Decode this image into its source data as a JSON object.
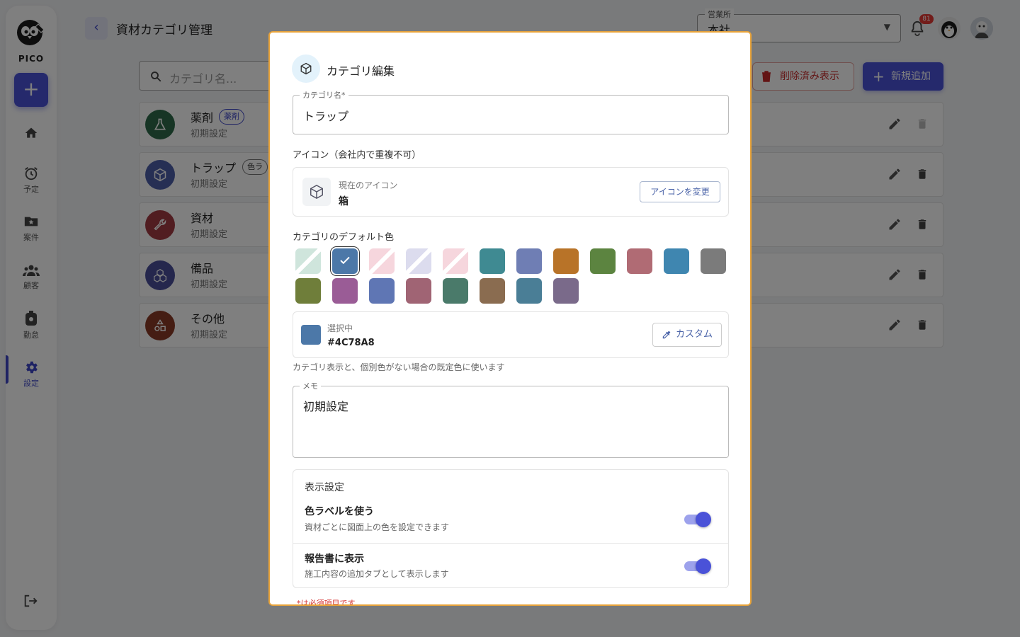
{
  "app": {
    "logo_text": "PICO"
  },
  "sidebar": {
    "items": [
      {
        "label": "",
        "icon": "home-icon"
      },
      {
        "label": "予定",
        "icon": "alarm-icon"
      },
      {
        "label": "案件",
        "icon": "folder-star-icon"
      },
      {
        "label": "顧客",
        "icon": "group-icon"
      },
      {
        "label": "勤怠",
        "icon": "timer-icon"
      },
      {
        "label": "設定",
        "icon": "gear-icon",
        "active": true
      }
    ]
  },
  "header": {
    "title": "資材カテゴリ管理",
    "office_label": "営業所",
    "office_value": "本社",
    "notification_count": "81"
  },
  "toolbar": {
    "search_placeholder": "カテゴリ名...",
    "show_deleted_label": "削除済み表示",
    "new_label": "新規追加"
  },
  "categories": [
    {
      "name": "薬剤",
      "badge": "薬剤",
      "memo": "初期設定",
      "color": "#2e6b4a",
      "icon": "flask-icon"
    },
    {
      "name": "トラップ",
      "badge": "色ラ",
      "memo": "初期設定",
      "color": "#4c5ea8",
      "icon": "box-icon"
    },
    {
      "name": "資材",
      "badge": "",
      "memo": "初期設定",
      "color": "#a33a42",
      "icon": "wrench-icon"
    },
    {
      "name": "備品",
      "badge": "",
      "memo": "初期設定",
      "color": "#4a4f9a",
      "icon": "cubes-icon"
    },
    {
      "name": "その他",
      "badge": "",
      "memo": "初期設定",
      "color": "#8a3b27",
      "icon": "shapes-icon"
    }
  ],
  "dialog": {
    "title": "カテゴリ編集",
    "name_label": "カテゴリ名*",
    "name_value": "トラップ",
    "icon_section_label": "アイコン（会社内で重複不可）",
    "current_icon_caption": "現在のアイコン",
    "current_icon_name": "箱",
    "change_icon_label": "アイコンを変更",
    "color_section_label": "カテゴリのデフォルト色",
    "swatches": [
      {
        "color": "#cfe5dc",
        "disabled": true
      },
      {
        "color": "#4c78a8",
        "selected": true
      },
      {
        "color": "#f6d6dd",
        "disabled": true
      },
      {
        "color": "#dcdcee",
        "disabled": true
      },
      {
        "color": "#f6d6dd",
        "disabled": true
      },
      {
        "color": "#3f8a92"
      },
      {
        "color": "#6f7eb4"
      },
      {
        "color": "#b87328"
      },
      {
        "color": "#5c8440"
      },
      {
        "color": "#b06b74"
      },
      {
        "color": "#3f86b0"
      },
      {
        "color": "#7b7b7b"
      },
      {
        "color": "#6f7e3a"
      },
      {
        "color": "#9a5c96"
      },
      {
        "color": "#5f76b4"
      },
      {
        "color": "#a06474"
      },
      {
        "color": "#4a7a6a"
      },
      {
        "color": "#8a6c50"
      },
      {
        "color": "#4a7e96"
      },
      {
        "color": "#7a6a8a"
      }
    ],
    "selected_caption": "選択中",
    "selected_hex": "#4C78A8",
    "custom_label": "カスタム",
    "color_help": "カテゴリ表示と、個別色がない場合の既定色に使います",
    "memo_label": "メモ",
    "memo_value": "初期設定",
    "display_title": "表示設定",
    "toggles": [
      {
        "title": "色ラベルを使う",
        "desc": "資材ごとに図面上の色を設定できます",
        "on": true
      },
      {
        "title": "報告書に表示",
        "desc": "施工内容の追加タブとして表示します",
        "on": true
      }
    ],
    "required_note": "*は必須項目です"
  }
}
